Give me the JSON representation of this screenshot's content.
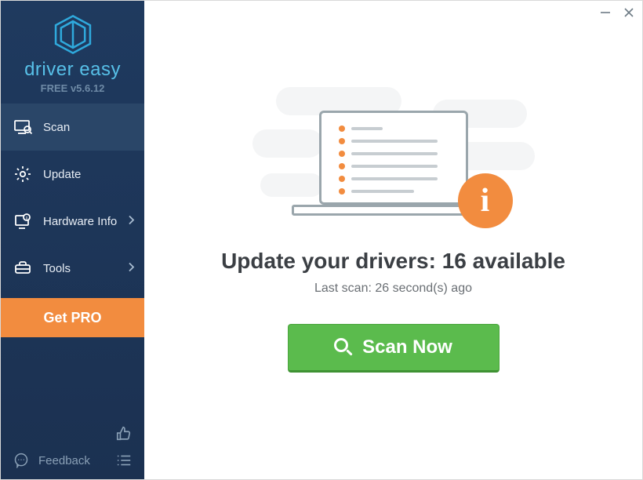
{
  "app": {
    "name": "driver easy",
    "version_line": "FREE v5.6.12"
  },
  "sidebar": {
    "items": [
      {
        "label": "Scan",
        "has_chevron": false
      },
      {
        "label": "Update",
        "has_chevron": false
      },
      {
        "label": "Hardware Info",
        "has_chevron": true
      },
      {
        "label": "Tools",
        "has_chevron": true
      }
    ],
    "pro_button": "Get PRO",
    "feedback_label": "Feedback"
  },
  "main": {
    "headline": "Update your drivers: 16 available",
    "subline": "Last scan: 26 second(s) ago",
    "scan_button": "Scan Now"
  }
}
